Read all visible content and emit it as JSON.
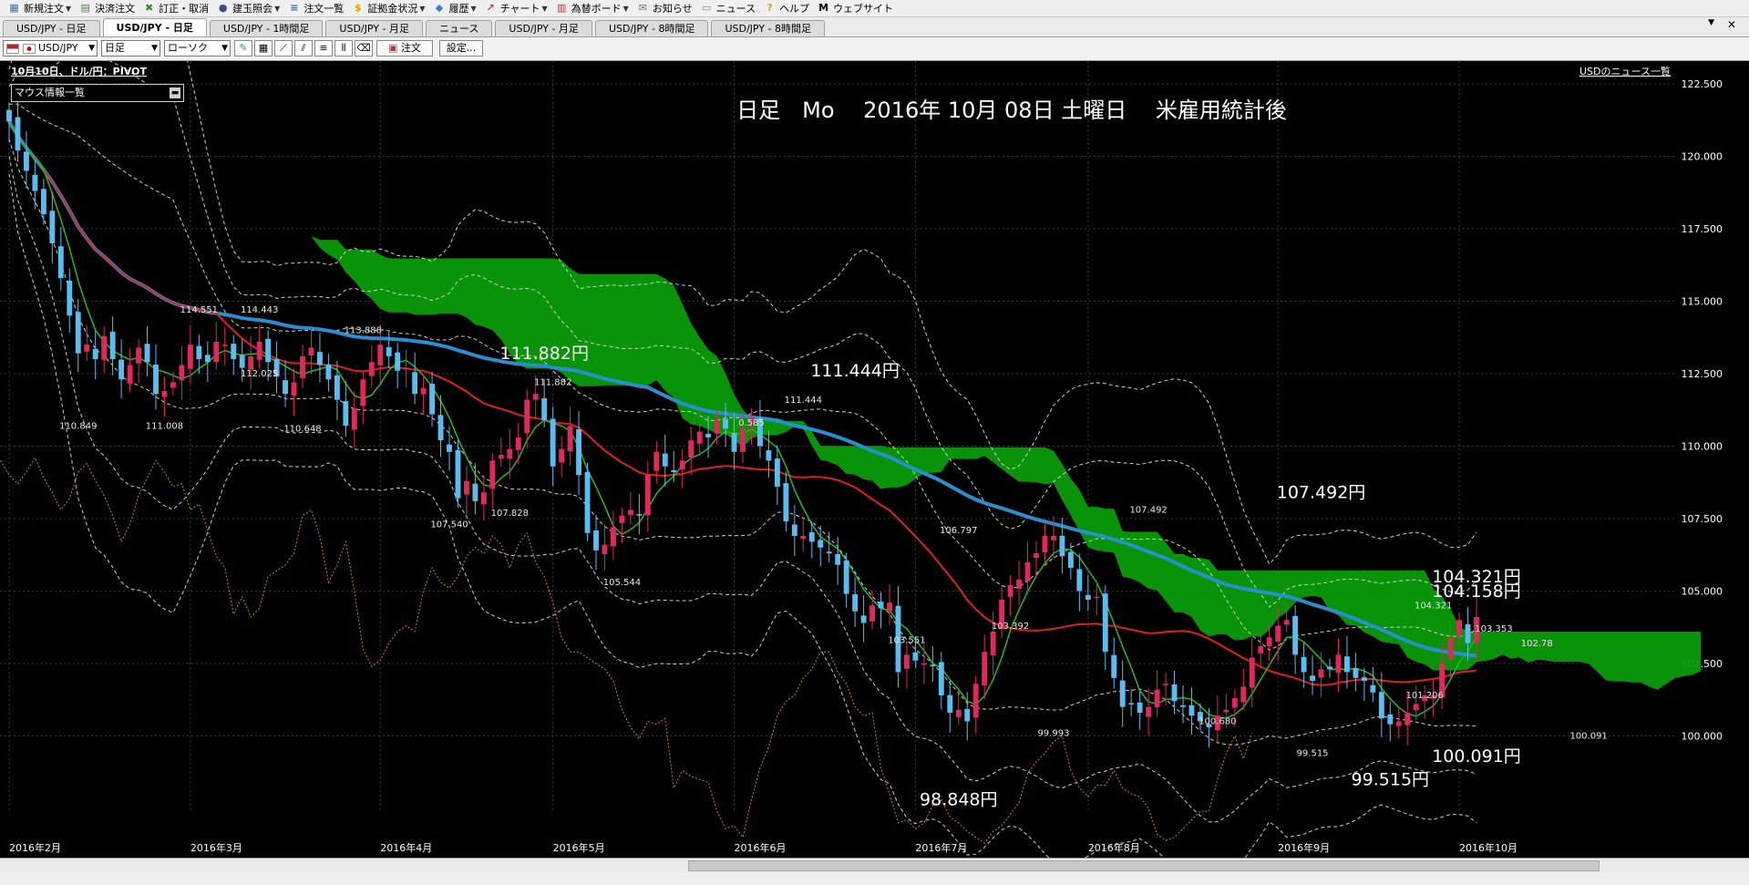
{
  "menu": [
    {
      "label": "新規注文",
      "icon": "new-order-icon",
      "glyph": "▦",
      "color": "#3a6fb0",
      "dropdown": true
    },
    {
      "label": "決済注文",
      "icon": "settle-order-icon",
      "glyph": "▤",
      "color": "#4a8a3a",
      "dropdown": false
    },
    {
      "label": "訂正・取消",
      "icon": "correct-cancel-icon",
      "glyph": "✖",
      "color": "#2e8b2e",
      "dropdown": false
    },
    {
      "label": "建玉照会",
      "icon": "position-icon",
      "glyph": "●",
      "color": "#2f4f8f",
      "dropdown": true
    },
    {
      "label": "注文一覧",
      "icon": "order-list-icon",
      "glyph": "≡",
      "color": "#3a6fb0",
      "dropdown": false
    },
    {
      "label": "証拠金状況",
      "icon": "margin-icon",
      "glyph": "$",
      "color": "#d9a400",
      "dropdown": true
    },
    {
      "label": "履歴",
      "icon": "history-icon",
      "glyph": "◆",
      "color": "#3a7fd0",
      "dropdown": true
    },
    {
      "label": "チャート",
      "icon": "chart-icon",
      "glyph": "↗",
      "color": "#c04040",
      "dropdown": true
    },
    {
      "label": "為替ボード",
      "icon": "board-icon",
      "glyph": "▥",
      "color": "#c03030",
      "dropdown": true
    },
    {
      "label": "お知らせ",
      "icon": "mail-icon",
      "glyph": "✉",
      "color": "#707070",
      "dropdown": false
    },
    {
      "label": "ニュース",
      "icon": "news-icon",
      "glyph": "▭",
      "color": "#808080",
      "dropdown": false
    },
    {
      "label": "ヘルプ",
      "icon": "help-icon",
      "glyph": "?",
      "color": "#e0a000",
      "dropdown": false
    },
    {
      "label": "ウェブサイト",
      "icon": "website-icon",
      "glyph": "M",
      "color": "#000000",
      "dropdown": false
    }
  ],
  "tabs": [
    {
      "label": "USD/JPY - 日足",
      "active": false
    },
    {
      "label": "USD/JPY - 日足",
      "active": true
    },
    {
      "label": "USD/JPY - 1時間足",
      "active": false
    },
    {
      "label": "USD/JPY - 月足",
      "active": false
    },
    {
      "label": "ニュース",
      "active": false
    },
    {
      "label": "USD/JPY - 月足",
      "active": false
    },
    {
      "label": "USD/JPY - 8時間足",
      "active": false
    },
    {
      "label": "USD/JPY - 8時間足",
      "active": false
    }
  ],
  "toolbar": {
    "symbol": "USD/JPY",
    "timeframe": "日足",
    "chart_type": "ローソク",
    "order_label": "注文",
    "settings_label": "設定..."
  },
  "chart_header": {
    "info": "10月10日、ドル/円：PIVOT",
    "news_link": "USDのニュース一覧",
    "mouse_panel": "マウス情報一覧"
  },
  "colors": {
    "bull": "#e0285a",
    "bear": "#5bbcf0",
    "cloud": "#0a9b0a",
    "ma_blue": "#2a8fd0",
    "ma_red": "#e02020",
    "ma_green": "#22bb22",
    "chikou": "#c8871e"
  },
  "chart_data": {
    "type": "candlestick",
    "title": "日足　Mo　 2016年 10月 08日 土曜日　 米雇用統計後",
    "symbol": "USD/JPY",
    "ylim": [
      98.0,
      122.5
    ],
    "y_ticks": [
      100.0,
      102.5,
      105.0,
      107.5,
      110.0,
      112.5,
      115.0,
      117.5,
      120.0,
      122.5
    ],
    "y_tick_labels": [
      "100.000",
      "102.500",
      "105.000",
      "107.500",
      "110.000",
      "112.500",
      "115.000",
      "117.500",
      "120.000",
      "122.500"
    ],
    "x_labels": [
      "2016年2月",
      "2016年3月",
      "2016年4月",
      "2016年5月",
      "2016年6月",
      "2016年7月",
      "2016年8月",
      "2016年9月",
      "2016年10月"
    ],
    "x_label_index": [
      0,
      21,
      43,
      63,
      84,
      105,
      125,
      147,
      168
    ],
    "grid": true,
    "closes": [
      121.2,
      120.2,
      119.5,
      118.8,
      118.0,
      117.0,
      115.8,
      114.5,
      113.2,
      113.5,
      113.0,
      113.8,
      113.0,
      112.3,
      112.8,
      113.4,
      112.9,
      111.8,
      111.9,
      112.2,
      112.8,
      113.5,
      113.0,
      112.9,
      113.6,
      113.5,
      113.0,
      112.7,
      113.1,
      113.6,
      112.9,
      112.4,
      111.8,
      112.2,
      113.1,
      113.4,
      112.8,
      112.3,
      111.6,
      110.7,
      111.3,
      112.3,
      112.9,
      113.5,
      113.1,
      112.6,
      112.7,
      111.8,
      112.0,
      111.1,
      110.2,
      109.8,
      108.2,
      108.8,
      108.1,
      108.4,
      109.5,
      109.7,
      109.9,
      110.3,
      111.6,
      111.8,
      110.9,
      109.3,
      109.9,
      110.7,
      109.0,
      107.0,
      106.4,
      106.6,
      107.2,
      107.6,
      107.8,
      107.6,
      109.0,
      109.8,
      109.3,
      109.1,
      109.5,
      110.2,
      110.5,
      110.3,
      110.9,
      110.6,
      109.8,
      110.6,
      111.0,
      110.0,
      109.5,
      108.6,
      107.4,
      106.9,
      106.9,
      106.7,
      106.5,
      106.3,
      105.9,
      104.9,
      104.3,
      103.9,
      104.5,
      104.4,
      104.6,
      102.2,
      102.8,
      102.6,
      102.5,
      102.4,
      101.4,
      100.8,
      100.9,
      100.5,
      101.8,
      102.9,
      103.6,
      104.7,
      105.2,
      105.4,
      106.0,
      106.3,
      106.9,
      106.9,
      106.2,
      105.8,
      105.0,
      104.7,
      104.8,
      102.9,
      102.0,
      101.0,
      101.1,
      100.8,
      101.0,
      101.6,
      101.8,
      101.2,
      101.0,
      100.7,
      100.5,
      100.3,
      100.7,
      100.9,
      101.3,
      101.7,
      102.7,
      103.1,
      103.4,
      103.8,
      104.0,
      102.8,
      102.2,
      101.9,
      102.3,
      102.3,
      102.8,
      102.2,
      102.0,
      101.9,
      101.5,
      100.6,
      100.4,
      100.5,
      100.8,
      101.1,
      101.4,
      101.4,
      102.5,
      103.4,
      104.0,
      103.2,
      104.1
    ],
    "annotations": [
      {
        "text": "111.882円",
        "i": 62,
        "price": 113.0
      },
      {
        "text": "111.444円",
        "i": 98,
        "price": 112.4
      },
      {
        "text": "107.492円",
        "i": 152,
        "price": 108.2
      },
      {
        "text": "104.321円",
        "i": 198,
        "price": 105.3
      },
      {
        "text": "104.158円",
        "i": 245,
        "price": 104.8
      },
      {
        "text": "98.848円",
        "i": 110,
        "price": 97.6
      },
      {
        "text": "99.515円",
        "i": 160,
        "price": 98.3
      },
      {
        "text": "100.091円",
        "i": 226,
        "price": 99.1
      }
    ],
    "small_labels": [
      {
        "text": "110.849",
        "i": 8,
        "price": 110.6
      },
      {
        "text": "111.008",
        "i": 18,
        "price": 110.6
      },
      {
        "text": "114.551",
        "i": 22,
        "price": 114.6
      },
      {
        "text": "114.443",
        "i": 29,
        "price": 114.6
      },
      {
        "text": "112.025",
        "i": 29,
        "price": 112.4
      },
      {
        "text": "110.648",
        "i": 34,
        "price": 110.5
      },
      {
        "text": "113.888",
        "i": 41,
        "price": 113.9
      },
      {
        "text": "107.540",
        "i": 51,
        "price": 107.2
      },
      {
        "text": "107.828",
        "i": 58,
        "price": 107.6
      },
      {
        "text": "111.882",
        "i": 63,
        "price": 112.1
      },
      {
        "text": "105.544",
        "i": 71,
        "price": 105.2
      },
      {
        "text": "0.585",
        "i": 86,
        "price": 110.7
      },
      {
        "text": "111.444",
        "i": 92,
        "price": 111.5
      },
      {
        "text": "106.797",
        "i": 110,
        "price": 107.0
      },
      {
        "text": "103.551",
        "i": 104,
        "price": 103.2
      },
      {
        "text": "103.392",
        "i": 116,
        "price": 103.7
      },
      {
        "text": "99.993",
        "i": 121,
        "price": 100.0
      },
      {
        "text": "107.492",
        "i": 132,
        "price": 107.7
      },
      {
        "text": "100.680",
        "i": 140,
        "price": 100.4
      },
      {
        "text": "99.515",
        "i": 151,
        "price": 99.3
      },
      {
        "text": "104.321",
        "i": 165,
        "price": 104.4
      },
      {
        "text": "101.206",
        "i": 164,
        "price": 101.3
      },
      {
        "text": "103.353",
        "i": 172,
        "price": 103.6
      },
      {
        "text": "102.78",
        "i": 177,
        "price": 103.1
      },
      {
        "text": "100.091",
        "i": 183,
        "price": 99.9
      }
    ]
  }
}
